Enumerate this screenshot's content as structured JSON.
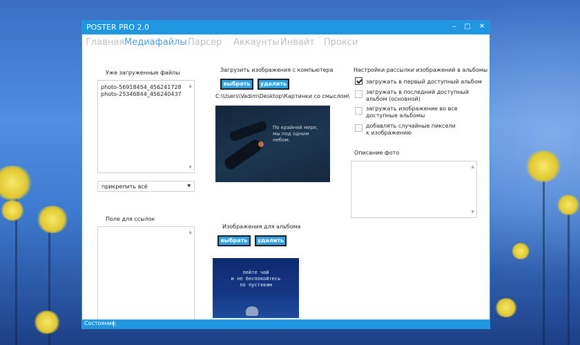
{
  "window": {
    "title": "POSTER PRO 2.0",
    "controls": [
      "‒",
      "□",
      "✕"
    ]
  },
  "tabs": [
    {
      "label": "Главная"
    },
    {
      "label": "Медиафайлы",
      "active": true
    },
    {
      "label": "Парсер"
    },
    {
      "label": "Аккаунты"
    },
    {
      "label": "Инвайт"
    },
    {
      "label": "Прокси"
    }
  ],
  "uploaded": {
    "heading": "Уже загруженные файлы",
    "files": [
      "photo-56918454_456241728",
      "photo-25346844_456240437"
    ],
    "attach_select": "прикрепить всё"
  },
  "links": {
    "heading": "Поле для ссылок"
  },
  "upload": {
    "heading": "Загрузить изображения с компьютера",
    "choose_label": "выбрать",
    "delete_label": "удалить",
    "path": "C:\\Users\\Vadim\\Desktop\\Картинки со смыслом\\",
    "preview_caption_lines": [
      "По крайней мере,",
      "мы под одним",
      "небом."
    ]
  },
  "album": {
    "heading": "Изображения для альбома",
    "choose_label": "выбрать",
    "delete_label": "удалить",
    "preview_caption_lines": [
      "пейте чай",
      "и не беспокойтесь",
      "по пустякам"
    ]
  },
  "settings": {
    "heading": "Настройки рассылки изображений в альбомы",
    "options": [
      {
        "lines": [
          "загружать в первый доступный альбом"
        ],
        "checked": true
      },
      {
        "lines": [
          "загружать в последний доступный",
          "альбом (основной)"
        ],
        "checked": false
      },
      {
        "lines": [
          "загружать изображение во все",
          "доступные альбомы"
        ],
        "checked": false
      },
      {
        "lines": [
          "добавлять случайные пиксели",
          "к изображению"
        ],
        "checked": false
      }
    ],
    "photo_desc_heading": "Описание фото"
  },
  "statusbar": {
    "label": "Состояние:"
  },
  "colors": {
    "accent": "#2196e0",
    "button": "#2fa3e6",
    "active_tab": "#4a9fd8"
  }
}
